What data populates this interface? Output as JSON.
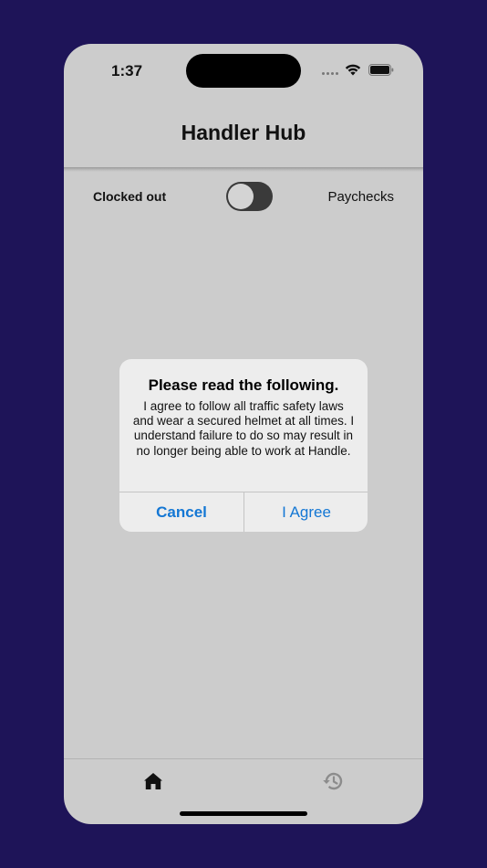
{
  "status_bar": {
    "time": "1:37"
  },
  "header": {
    "title": "Handler Hub"
  },
  "clock": {
    "status_label": "Clocked out",
    "toggle_on": false
  },
  "nav": {
    "paychecks_label": "Paychecks"
  },
  "alert": {
    "title": "Please read the following.",
    "message": "I agree to follow all traffic safety laws and wear a secured helmet at all times. I understand failure to do so may result in no longer being able to work at Handle.",
    "cancel_label": "Cancel",
    "agree_label": "I Agree"
  },
  "tabs": [
    {
      "icon": "home-icon",
      "active": true
    },
    {
      "icon": "history-icon",
      "active": false
    }
  ],
  "colors": {
    "background": "#1e1458",
    "screen": "#cccccc",
    "alert_button": "#1477d4"
  }
}
